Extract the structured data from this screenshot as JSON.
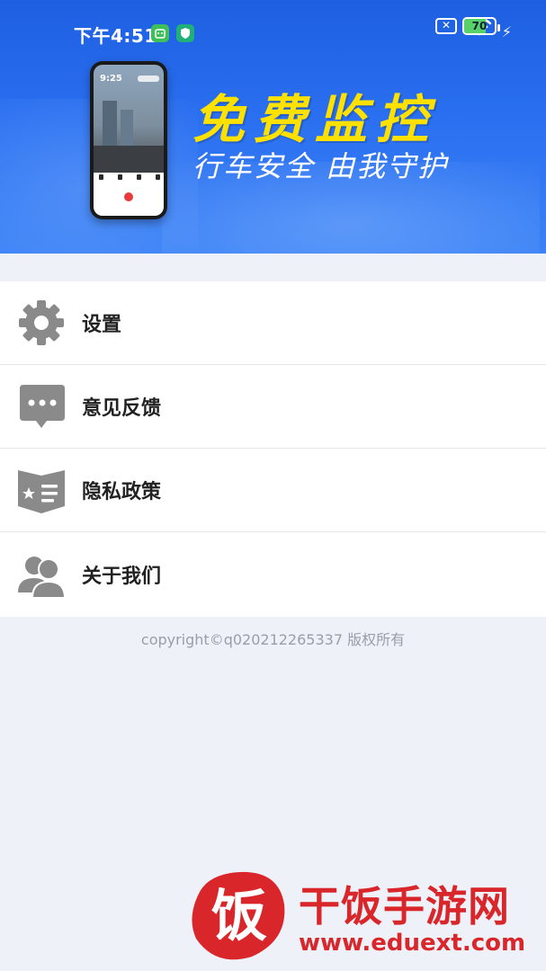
{
  "status_bar": {
    "time": "下午4:51",
    "battery_level": 70,
    "battery_text": "70"
  },
  "banner": {
    "title": "免费监控",
    "subtitle": "行车安全 由我守护",
    "phone_time": "9:25"
  },
  "menu": {
    "items": [
      {
        "label": "设置",
        "icon": "gear-icon"
      },
      {
        "label": "意见反馈",
        "icon": "chat-bubble-icon"
      },
      {
        "label": "隐私政策",
        "icon": "shield-list-icon"
      },
      {
        "label": "关于我们",
        "icon": "users-icon"
      }
    ]
  },
  "footer": {
    "copyright": "copyright©q020212265337 版权所有"
  },
  "watermark": {
    "logo_char": "饭",
    "name": "干饭手游网",
    "url": "www.eduext.com"
  },
  "colors": {
    "banner_blue": "#2a6ff0",
    "promo_yellow": "#ffe100",
    "icon_gray": "#8a8a8a",
    "watermark_red": "#d9262b"
  }
}
